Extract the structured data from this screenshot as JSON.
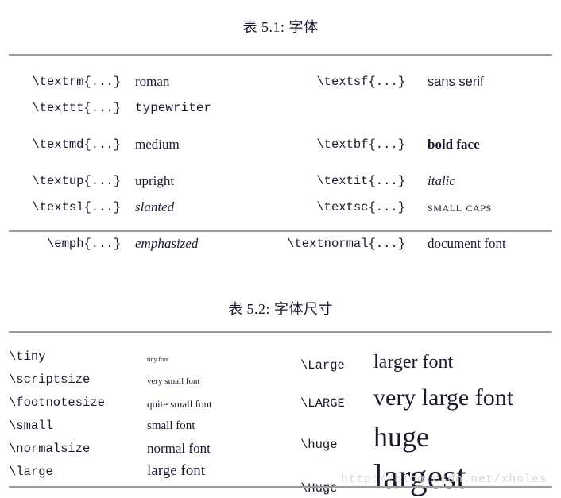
{
  "page": {
    "background_color": "#ffffff",
    "text_color": "#1a1a2e",
    "rule_color": "#9a9a9a"
  },
  "watermark": {
    "text": "http://blog.csdn.net/xholes",
    "color": "#d8d8dc"
  },
  "tables": [
    {
      "id": "table-1",
      "caption": "表 5.1: 字体",
      "groups": [
        {
          "rows": [
            {
              "left_cmd": "\\textrm{...}",
              "left_val": "roman",
              "left_style": "fs-roman",
              "right_cmd": "\\textsf{...}",
              "right_val": "sans serif",
              "right_style": "fs-sans"
            },
            {
              "left_cmd": "\\texttt{...}",
              "left_val": "typewriter",
              "left_style": "fs-typewriter",
              "right_cmd": "",
              "right_val": "",
              "right_style": ""
            }
          ]
        },
        {
          "rows": [
            {
              "left_cmd": "\\textmd{...}",
              "left_val": "medium",
              "left_style": "fs-medium",
              "right_cmd": "\\textbf{...}",
              "right_val": "bold face",
              "right_style": "fs-bold"
            }
          ]
        },
        {
          "rows": [
            {
              "left_cmd": "\\textup{...}",
              "left_val": "upright",
              "left_style": "fs-upright",
              "right_cmd": "\\textit{...}",
              "right_val": "italic",
              "right_style": "fs-italic"
            },
            {
              "left_cmd": "\\textsl{...}",
              "left_val": "slanted",
              "left_style": "fs-slanted",
              "right_cmd": "\\textsc{...}",
              "right_val": "small caps",
              "right_style": "fs-smallcaps"
            }
          ]
        },
        {
          "rows": [
            {
              "left_cmd": "\\emph{...}",
              "left_val": "emphasized",
              "left_style": "fs-emph",
              "right_cmd": "\\textnormal{...}",
              "right_val": "document font",
              "right_style": "fs-normal"
            }
          ]
        }
      ]
    },
    {
      "id": "table-2",
      "caption": "表 5.2: 字体尺寸",
      "rows": [
        {
          "left_cmd": "\\tiny",
          "left_val": "tiny font",
          "left_size": "sz-tiny",
          "right_cmd": "\\Large",
          "right_val": "larger font",
          "right_size": "sz-Large"
        },
        {
          "left_cmd": "\\scriptsize",
          "left_val": "very small font",
          "left_size": "sz-script",
          "right_cmd": "\\LARGE",
          "right_val": "very large font",
          "right_size": "sz-LARGE"
        },
        {
          "left_cmd": "\\footnotesize",
          "left_val": "quite small font",
          "left_size": "sz-footnote",
          "right_cmd": "",
          "right_val": "",
          "right_size": ""
        },
        {
          "left_cmd": "\\small",
          "left_val": "small font",
          "left_size": "sz-small",
          "right_cmd": "\\huge",
          "right_val": "huge",
          "right_size": "sz-huge"
        },
        {
          "left_cmd": "\\normalsize",
          "left_val": "normal font",
          "left_size": "sz-normalsize",
          "right_cmd": "",
          "right_val": "",
          "right_size": ""
        },
        {
          "left_cmd": "\\large",
          "left_val": "large font",
          "left_size": "sz-large",
          "right_cmd": "\\Huge",
          "right_val": "largest",
          "right_size": "sz-Huge"
        }
      ]
    }
  ]
}
